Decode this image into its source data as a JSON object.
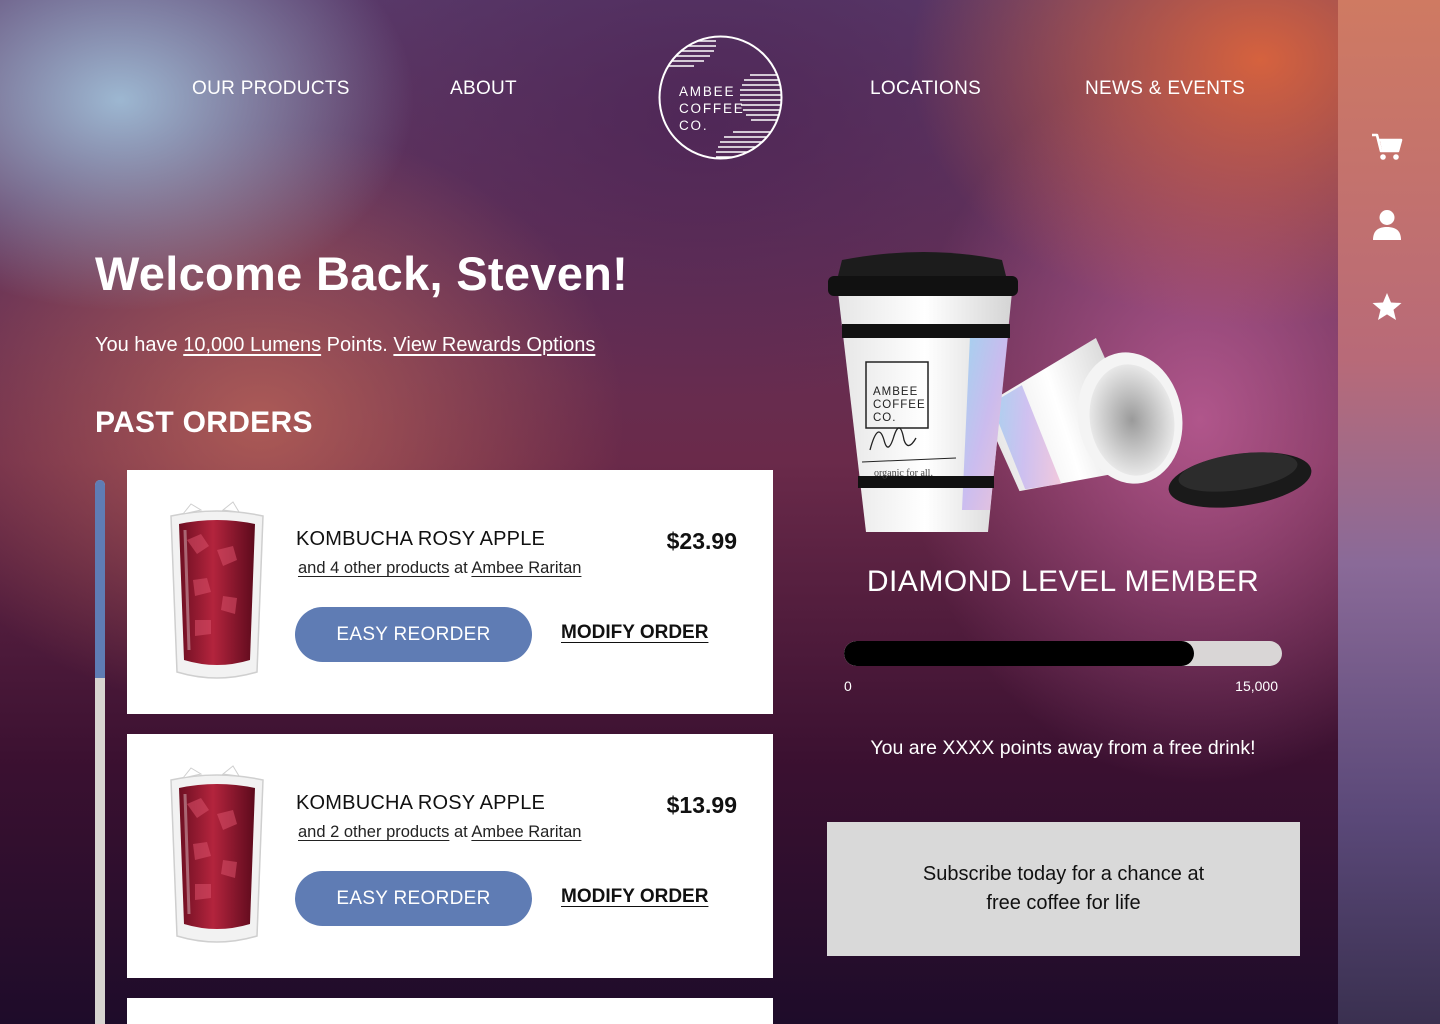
{
  "nav": {
    "left": [
      "OUR PRODUCTS",
      "ABOUT"
    ],
    "right": [
      "LOCATIONS",
      "NEWS & EVENTS"
    ],
    "logo_lines": [
      "AMBEE",
      "COFFEE",
      "CO."
    ]
  },
  "rail": {
    "icons": [
      "cart-icon",
      "user-icon",
      "star-icon"
    ]
  },
  "welcome": {
    "title": "Welcome Back, Steven!",
    "points_prefix": "You have ",
    "points_link": "10,000 Lumens",
    "points_mid": " Points. ",
    "rewards_link": "View Rewards Options"
  },
  "past_orders": {
    "heading": "PAST ORDERS",
    "orders": [
      {
        "title": "KOMBUCHA ROSY APPLE",
        "price": "$23.99",
        "others": "and 4 other products",
        "at": " at ",
        "store": "Ambee Raritan",
        "reorder": "EASY REORDER",
        "modify": "MODIFY ORDER"
      },
      {
        "title": "KOMBUCHA ROSY APPLE",
        "price": "$13.99",
        "others": "and 2 other products",
        "at": " at ",
        "store": "Ambee Raritan",
        "reorder": "EASY REORDER",
        "modify": "MODIFY ORDER"
      }
    ]
  },
  "member": {
    "level": "DIAMOND LEVEL MEMBER",
    "cup_text": [
      "AMBEE",
      "COFFEE",
      "CO."
    ],
    "cup_tagline": "organic for all.",
    "progress_min": "0",
    "progress_max": "15,000",
    "progress_fraction": 0.8,
    "away_text": "You are XXXX points away from a free drink!",
    "subscribe": "Subscribe today for a chance at free coffee for life"
  },
  "colors": {
    "accent": "#5f7cb4",
    "progress_fill": "#000000",
    "progress_track": "#d9d6d6",
    "subscribe_bg": "#d9d9d9"
  }
}
